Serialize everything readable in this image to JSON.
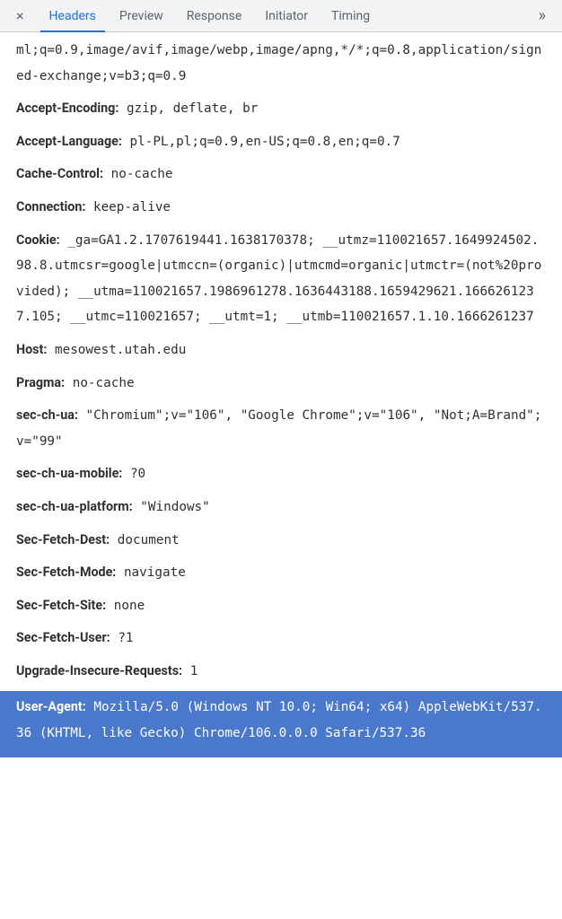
{
  "tabs": {
    "headers": "Headers",
    "preview": "Preview",
    "response": "Response",
    "initiator": "Initiator",
    "timing": "Timing"
  },
  "continuation_line": "ml;q=0.9,image/avif,image/webp,image/apng,*/*;q=0.8,application/signed-exchange;v=b3;q=0.9",
  "headers": [
    {
      "name": "Accept-Encoding:",
      "value": "gzip, deflate, br"
    },
    {
      "name": "Accept-Language:",
      "value": "pl-PL,pl;q=0.9,en-US;q=0.8,en;q=0.7"
    },
    {
      "name": "Cache-Control:",
      "value": "no-cache"
    },
    {
      "name": "Connection:",
      "value": "keep-alive"
    },
    {
      "name": "Cookie:",
      "value": "_ga=GA1.2.1707619441.1638170378; __utmz=110021657.1649924502.98.8.utmcsr=google|utmccn=(organic)|utmcmd=organic|utmctr=(not%20provided); __utma=110021657.1986961278.1636443188.1659429621.1666261237.105; __utmc=110021657; __utmt=1; __utmb=110021657.1.10.1666261237"
    },
    {
      "name": "Host:",
      "value": "mesowest.utah.edu"
    },
    {
      "name": "Pragma:",
      "value": "no-cache"
    },
    {
      "name": "sec-ch-ua:",
      "value": "\"Chromium\";v=\"106\", \"Google Chrome\";v=\"106\", \"Not;A=Brand\";v=\"99\""
    },
    {
      "name": "sec-ch-ua-mobile:",
      "value": "?0"
    },
    {
      "name": "sec-ch-ua-platform:",
      "value": "\"Windows\""
    },
    {
      "name": "Sec-Fetch-Dest:",
      "value": "document"
    },
    {
      "name": "Sec-Fetch-Mode:",
      "value": "navigate"
    },
    {
      "name": "Sec-Fetch-Site:",
      "value": "none"
    },
    {
      "name": "Sec-Fetch-User:",
      "value": "?1"
    },
    {
      "name": "Upgrade-Insecure-Requests:",
      "value": "1"
    }
  ],
  "highlighted_header": {
    "name": "User-Agent:",
    "value": "Mozilla/5.0 (Windows NT 10.0; Win64; x64) AppleWebKit/537.36 (KHTML, like Gecko) Chrome/106.0.0.0 Safari/537.36"
  }
}
